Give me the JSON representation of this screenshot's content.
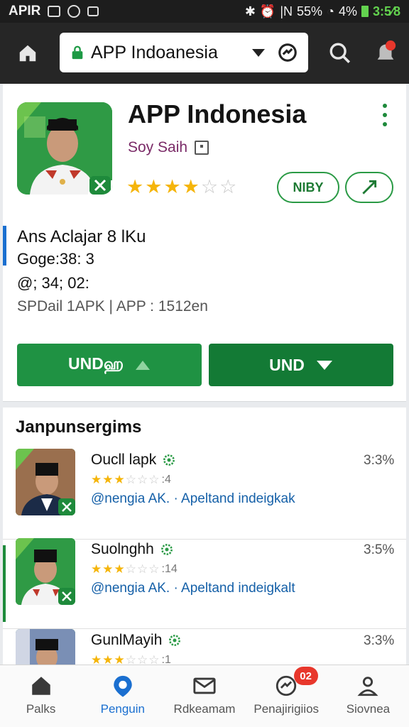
{
  "status_bar": {
    "carrier": "APIR",
    "signal_text": "55%",
    "battery_text": "4%",
    "time": "3:5⁄8"
  },
  "app_bar": {
    "url_text": "APP Indoanesia"
  },
  "app": {
    "title": "APP Indonesia",
    "developer": "Soy Saih",
    "rating": 4,
    "rating_max": 6,
    "badge_label": "NIBY",
    "info_title": "Ans Aclajar 8 lKu",
    "info_line1": "Goge:38: 3",
    "info_line2": "@; 34; 02:",
    "info_line3": "SPDail 1APK | APP : 1512en",
    "button1_label": "UNDஹ",
    "button2_label": "UND"
  },
  "list": {
    "title": "Janpunsergims",
    "items": [
      {
        "name": "Oucll lapk",
        "stars": 3,
        "count": "4",
        "sub": "@nengia AK. · Apeltand indeigkak",
        "size": "3:3%"
      },
      {
        "name": "Suolnghh",
        "stars": 3,
        "count": "14",
        "sub": "@nengia AK. · Apeltand indeigkalt",
        "size": "3:5%"
      },
      {
        "name": "GunlMayih",
        "stars": 3,
        "count": "1",
        "sub": "",
        "size": "3:3%"
      }
    ]
  },
  "bottom_nav": {
    "items": [
      {
        "label": "Palks",
        "icon": "home-icon"
      },
      {
        "label": "Penguin",
        "icon": "location-icon",
        "active": true
      },
      {
        "label": "Rdkeamam",
        "icon": "mail-icon"
      },
      {
        "label": "Penajirigiios",
        "icon": "sync-icon",
        "badge": "02"
      },
      {
        "label": "Siovnea",
        "icon": "person-icon"
      }
    ]
  },
  "colors": {
    "primary_green": "#1f9243",
    "dark_green": "#137a35",
    "accent_blue": "#1a6fd0",
    "star_gold": "#f5b50a",
    "badge_red": "#e8372c"
  }
}
